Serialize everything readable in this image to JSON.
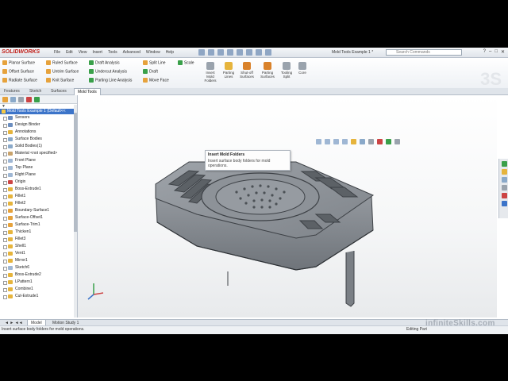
{
  "app": {
    "logo": "SOLIDWORKS",
    "menus": [
      "File",
      "Edit",
      "View",
      "Insert",
      "Tools",
      "Advanced",
      "Window",
      "Help"
    ],
    "document_title": "Mold Tools Example 1 *",
    "search_placeholder": "Search Commands",
    "window_buttons": [
      "?",
      "–",
      "□",
      "✕"
    ]
  },
  "ribbon": {
    "commands": [
      {
        "label": "Planar Surface",
        "color": "#e6a23c"
      },
      {
        "label": "Offset Surface",
        "color": "#e6a23c"
      },
      {
        "label": "Radiate Surface",
        "color": "#e6a23c"
      },
      {
        "label": "Ruled Surface",
        "color": "#e6a23c"
      },
      {
        "label": "Untrim Surface",
        "color": "#e6a23c"
      },
      {
        "label": "Knit Surface",
        "color": "#e6a23c"
      },
      {
        "label": "Draft Analysis",
        "color": "#3aa04a"
      },
      {
        "label": "Undercut Analysis",
        "color": "#3aa04a"
      },
      {
        "label": "Parting Line Analysis",
        "color": "#3aa04a"
      },
      {
        "label": "Split Line",
        "color": "#e6a23c"
      },
      {
        "label": "Draft",
        "color": "#3aa04a"
      },
      {
        "label": "Move Face",
        "color": "#e6a23c"
      },
      {
        "label": "Scale",
        "color": "#3aa04a"
      }
    ],
    "big_buttons": [
      {
        "label": "Insert Mold Folders",
        "color": "#9aa3ad"
      },
      {
        "label": "Parting Lines",
        "color": "#e6b43c"
      },
      {
        "label": "Shut-off Surfaces",
        "color": "#d9822b"
      },
      {
        "label": "Parting Surfaces",
        "color": "#d9822b"
      },
      {
        "label": "Tooling Split",
        "color": "#9aa3ad"
      },
      {
        "label": "Core",
        "color": "#9aa3ad"
      }
    ],
    "tabs": [
      "Features",
      "Sketch",
      "Surfaces",
      "Mold Tools"
    ],
    "active_tab": "Mold Tools"
  },
  "feature_tree": {
    "root": "Mold Tools Example 1 (Default<<",
    "items": [
      {
        "label": "Sensors",
        "color": "#6c8ebf"
      },
      {
        "label": "Design Binder",
        "color": "#6c8ebf"
      },
      {
        "label": "Annotations",
        "color": "#e6b43c"
      },
      {
        "label": "Surface Bodies",
        "color": "#8aa9c9"
      },
      {
        "label": "Solid Bodies(1)",
        "color": "#8aa9c9"
      },
      {
        "label": "Material <not specified>",
        "color": "#c9a36c"
      },
      {
        "label": "Front Plane",
        "color": "#9fb7d4"
      },
      {
        "label": "Top Plane",
        "color": "#9fb7d4"
      },
      {
        "label": "Right Plane",
        "color": "#9fb7d4"
      },
      {
        "label": "Origin",
        "color": "#c44"
      },
      {
        "label": "Boss-Extrude1",
        "color": "#e6b43c"
      },
      {
        "label": "Fillet1",
        "color": "#e6b43c"
      },
      {
        "label": "Fillet2",
        "color": "#e6b43c"
      },
      {
        "label": "Boundary-Surface1",
        "color": "#e6a23c"
      },
      {
        "label": "Surface-Offset1",
        "color": "#e6a23c"
      },
      {
        "label": "Surface-Trim1",
        "color": "#e6a23c"
      },
      {
        "label": "Thicken1",
        "color": "#e6b43c"
      },
      {
        "label": "Fillet3",
        "color": "#e6b43c"
      },
      {
        "label": "Shell1",
        "color": "#e6b43c"
      },
      {
        "label": "Vent1",
        "color": "#e6b43c"
      },
      {
        "label": "Mirror1",
        "color": "#e6b43c"
      },
      {
        "label": "Sketch6",
        "color": "#9fb7d4"
      },
      {
        "label": "Boss-Extrude2",
        "color": "#e6b43c"
      },
      {
        "label": "LPattern1",
        "color": "#e6b43c"
      },
      {
        "label": "Combine1",
        "color": "#e6b43c"
      },
      {
        "label": "Cut-Extrude1",
        "color": "#e6b43c"
      }
    ]
  },
  "tooltip": {
    "title": "Insert Mold Folders",
    "description": "Insert surface body folders for mold operations."
  },
  "bottom_tabs": [
    "Model",
    "Motion Study 1"
  ],
  "status": {
    "left": "Insert surface body folders for mold operations.",
    "right": "Editing Part"
  },
  "watermark": "infiniteSkills.com",
  "colors": {
    "root_highlight": "#3c74c9",
    "model": "#8e9399"
  }
}
